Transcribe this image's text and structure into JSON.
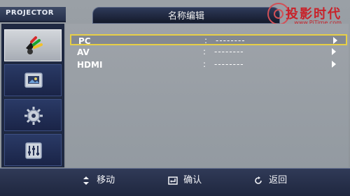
{
  "header": {
    "brand": "PROJECTOR",
    "title": "名称编辑",
    "logo_text": "投影时代",
    "logo_sub": "www.PjTime.com"
  },
  "sidebar": {
    "items": [
      {
        "icon": "input-cables-icon",
        "active": true
      },
      {
        "icon": "picture-icon",
        "active": false
      },
      {
        "icon": "settings-gear-icon",
        "active": false
      },
      {
        "icon": "equalizer-icon",
        "active": false
      }
    ]
  },
  "menu": {
    "rows": [
      {
        "label": "PC",
        "colon": ":",
        "value": "--------",
        "selected": true
      },
      {
        "label": "AV",
        "colon": ":",
        "value": "--------",
        "selected": false
      },
      {
        "label": "HDMI",
        "colon": ":",
        "value": "--------",
        "selected": false
      }
    ]
  },
  "footer": {
    "move": "移动",
    "confirm": "确认",
    "back": "返回"
  },
  "colors": {
    "accent_selection": "#e7cf46",
    "panel_bg": "#9ea3a9",
    "sidebar_bg": "#1f2942",
    "logo_red": "#c8222a"
  }
}
